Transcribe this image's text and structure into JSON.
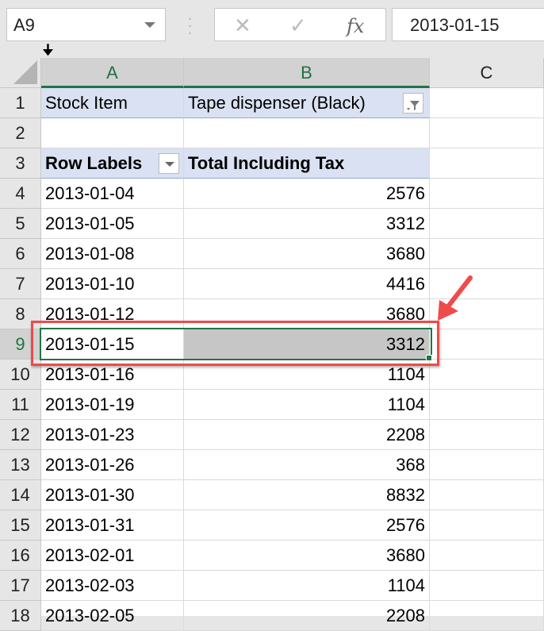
{
  "name_box": "A9",
  "formula_bar": {
    "cancel_icon": "✕",
    "enter_icon": "✓",
    "fx_label": "fx",
    "value": "2013-01-15"
  },
  "columns": [
    "A",
    "B",
    "C"
  ],
  "selected_cell": "A9",
  "pivot": {
    "filter_label": "Stock Item",
    "filter_value": "Tape dispenser (Black)",
    "row_labels_header": "Row Labels",
    "value_header": "Total Including Tax",
    "rows": [
      {
        "row": "4",
        "date": "2013-01-04",
        "total": "2576"
      },
      {
        "row": "5",
        "date": "2013-01-05",
        "total": "3312"
      },
      {
        "row": "6",
        "date": "2013-01-08",
        "total": "3680"
      },
      {
        "row": "7",
        "date": "2013-01-10",
        "total": "4416"
      },
      {
        "row": "8",
        "date": "2013-01-12",
        "total": "3680"
      },
      {
        "row": "9",
        "date": "2013-01-15",
        "total": "3312"
      },
      {
        "row": "10",
        "date": "2013-01-16",
        "total": "1104"
      },
      {
        "row": "11",
        "date": "2013-01-19",
        "total": "1104"
      },
      {
        "row": "12",
        "date": "2013-01-23",
        "total": "2208"
      },
      {
        "row": "13",
        "date": "2013-01-26",
        "total": "368"
      },
      {
        "row": "14",
        "date": "2013-01-30",
        "total": "8832"
      },
      {
        "row": "15",
        "date": "2013-01-31",
        "total": "2576"
      },
      {
        "row": "16",
        "date": "2013-02-01",
        "total": "3680"
      },
      {
        "row": "17",
        "date": "2013-02-03",
        "total": "1104"
      },
      {
        "row": "18",
        "date": "2013-02-05",
        "total": "2208"
      }
    ]
  },
  "row_numbers": [
    "1",
    "2",
    "3"
  ],
  "colors": {
    "accent": "#217346",
    "annotation": "#f04a4a",
    "pivot_header": "#d9e1f2"
  }
}
